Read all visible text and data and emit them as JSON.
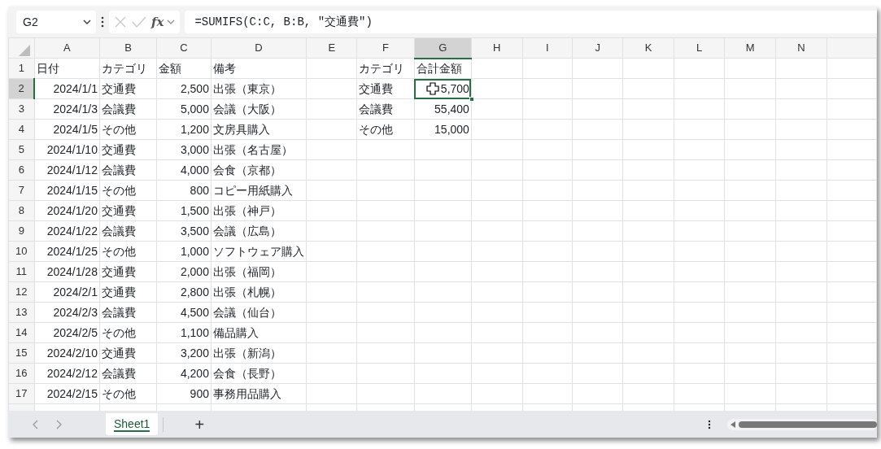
{
  "name_box": "G2",
  "formula_bar": {
    "fx": "fx",
    "formula": "=SUMIFS(C:C, B:B, \"交通費\")"
  },
  "columns": [
    {
      "label": "A",
      "selected": false
    },
    {
      "label": "B",
      "selected": false
    },
    {
      "label": "C",
      "selected": false
    },
    {
      "label": "D",
      "selected": false
    },
    {
      "label": "E",
      "selected": false
    },
    {
      "label": "F",
      "selected": false
    },
    {
      "label": "G",
      "selected": true
    },
    {
      "label": "H",
      "selected": false
    },
    {
      "label": "I",
      "selected": false
    },
    {
      "label": "J",
      "selected": false
    },
    {
      "label": "K",
      "selected": false
    },
    {
      "label": "L",
      "selected": false
    },
    {
      "label": "M",
      "selected": false
    },
    {
      "label": "N",
      "selected": false
    }
  ],
  "rows": [
    {
      "number": "1",
      "selected": false,
      "cells": {
        "A": {
          "text": "日付",
          "kind": "text"
        },
        "B": {
          "text": "カテゴリ",
          "kind": "text"
        },
        "C": {
          "text": "金額",
          "kind": "text"
        },
        "D": {
          "text": "備考",
          "kind": "text"
        },
        "F": {
          "text": "カテゴリ",
          "kind": "text"
        },
        "G": {
          "text": "合計金額",
          "kind": "text"
        }
      }
    },
    {
      "number": "2",
      "selected": true,
      "cells": {
        "A": {
          "text": "2024/1/1",
          "kind": "number"
        },
        "B": {
          "text": "交通費",
          "kind": "text"
        },
        "C": {
          "text": "2,500",
          "kind": "number"
        },
        "D": {
          "text": "出張（東京）",
          "kind": "text"
        },
        "F": {
          "text": "交通費",
          "kind": "text"
        },
        "G": {
          "text": "5,700",
          "kind": "number"
        }
      }
    },
    {
      "number": "3",
      "selected": false,
      "cells": {
        "A": {
          "text": "2024/1/3",
          "kind": "number"
        },
        "B": {
          "text": "会議費",
          "kind": "text"
        },
        "C": {
          "text": "5,000",
          "kind": "number"
        },
        "D": {
          "text": "会議（大阪）",
          "kind": "text"
        },
        "F": {
          "text": "会議費",
          "kind": "text"
        },
        "G": {
          "text": "55,400",
          "kind": "number"
        }
      }
    },
    {
      "number": "4",
      "selected": false,
      "cells": {
        "A": {
          "text": "2024/1/5",
          "kind": "number"
        },
        "B": {
          "text": "その他",
          "kind": "text"
        },
        "C": {
          "text": "1,200",
          "kind": "number"
        },
        "D": {
          "text": "文房具購入",
          "kind": "text"
        },
        "F": {
          "text": "その他",
          "kind": "text"
        },
        "G": {
          "text": "15,000",
          "kind": "number"
        }
      }
    },
    {
      "number": "5",
      "selected": false,
      "cells": {
        "A": {
          "text": "2024/1/10",
          "kind": "number"
        },
        "B": {
          "text": "交通費",
          "kind": "text"
        },
        "C": {
          "text": "3,000",
          "kind": "number"
        },
        "D": {
          "text": "出張（名古屋）",
          "kind": "text"
        }
      }
    },
    {
      "number": "6",
      "selected": false,
      "cells": {
        "A": {
          "text": "2024/1/12",
          "kind": "number"
        },
        "B": {
          "text": "会議費",
          "kind": "text"
        },
        "C": {
          "text": "4,000",
          "kind": "number"
        },
        "D": {
          "text": "会食（京都）",
          "kind": "text"
        }
      }
    },
    {
      "number": "7",
      "selected": false,
      "cells": {
        "A": {
          "text": "2024/1/15",
          "kind": "number"
        },
        "B": {
          "text": "その他",
          "kind": "text"
        },
        "C": {
          "text": "800",
          "kind": "number"
        },
        "D": {
          "text": "コピー用紙購入",
          "kind": "text"
        }
      }
    },
    {
      "number": "8",
      "selected": false,
      "cells": {
        "A": {
          "text": "2024/1/20",
          "kind": "number"
        },
        "B": {
          "text": "交通費",
          "kind": "text"
        },
        "C": {
          "text": "1,500",
          "kind": "number"
        },
        "D": {
          "text": "出張（神戸）",
          "kind": "text"
        }
      }
    },
    {
      "number": "9",
      "selected": false,
      "cells": {
        "A": {
          "text": "2024/1/22",
          "kind": "number"
        },
        "B": {
          "text": "会議費",
          "kind": "text"
        },
        "C": {
          "text": "3,500",
          "kind": "number"
        },
        "D": {
          "text": "会議（広島）",
          "kind": "text"
        }
      }
    },
    {
      "number": "10",
      "selected": false,
      "cells": {
        "A": {
          "text": "2024/1/25",
          "kind": "number"
        },
        "B": {
          "text": "その他",
          "kind": "text"
        },
        "C": {
          "text": "1,000",
          "kind": "number"
        },
        "D": {
          "text": "ソフトウェア購入",
          "kind": "text"
        }
      }
    },
    {
      "number": "11",
      "selected": false,
      "cells": {
        "A": {
          "text": "2024/1/28",
          "kind": "number"
        },
        "B": {
          "text": "交通費",
          "kind": "text"
        },
        "C": {
          "text": "2,000",
          "kind": "number"
        },
        "D": {
          "text": "出張（福岡）",
          "kind": "text"
        }
      }
    },
    {
      "number": "12",
      "selected": false,
      "cells": {
        "A": {
          "text": "2024/2/1",
          "kind": "number"
        },
        "B": {
          "text": "交通費",
          "kind": "text"
        },
        "C": {
          "text": "2,800",
          "kind": "number"
        },
        "D": {
          "text": "出張（札幌）",
          "kind": "text"
        }
      }
    },
    {
      "number": "13",
      "selected": false,
      "cells": {
        "A": {
          "text": "2024/2/3",
          "kind": "number"
        },
        "B": {
          "text": "会議費",
          "kind": "text"
        },
        "C": {
          "text": "4,500",
          "kind": "number"
        },
        "D": {
          "text": "会議（仙台）",
          "kind": "text"
        }
      }
    },
    {
      "number": "14",
      "selected": false,
      "cells": {
        "A": {
          "text": "2024/2/5",
          "kind": "number"
        },
        "B": {
          "text": "その他",
          "kind": "text"
        },
        "C": {
          "text": "1,100",
          "kind": "number"
        },
        "D": {
          "text": "備品購入",
          "kind": "text"
        }
      }
    },
    {
      "number": "15",
      "selected": false,
      "cells": {
        "A": {
          "text": "2024/2/10",
          "kind": "number"
        },
        "B": {
          "text": "交通費",
          "kind": "text"
        },
        "C": {
          "text": "3,200",
          "kind": "number"
        },
        "D": {
          "text": "出張（新潟）",
          "kind": "text"
        }
      }
    },
    {
      "number": "16",
      "selected": false,
      "cells": {
        "A": {
          "text": "2024/2/12",
          "kind": "number"
        },
        "B": {
          "text": "会議費",
          "kind": "text"
        },
        "C": {
          "text": "4,200",
          "kind": "number"
        },
        "D": {
          "text": "会食（長野）",
          "kind": "text"
        }
      }
    },
    {
      "number": "17",
      "selected": false,
      "cells": {
        "A": {
          "text": "2024/2/15",
          "kind": "number"
        },
        "B": {
          "text": "その他",
          "kind": "text"
        },
        "C": {
          "text": "900",
          "kind": "number"
        },
        "D": {
          "text": "事務用品購入",
          "kind": "text"
        }
      }
    }
  ],
  "sheet_tabs": [
    {
      "label": "Sheet1",
      "selected": true
    }
  ],
  "add_sheet": "+"
}
